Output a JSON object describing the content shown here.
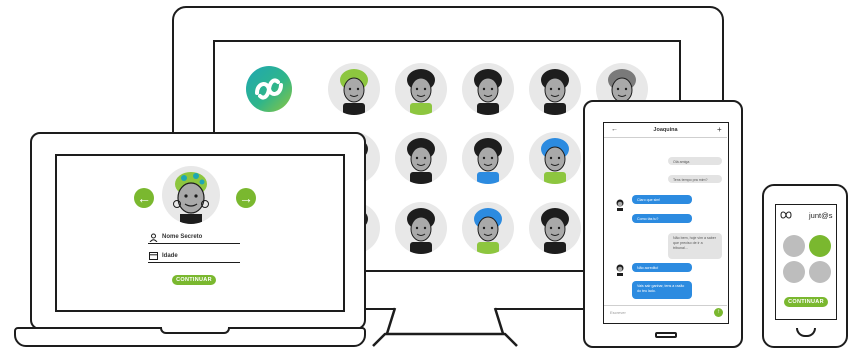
{
  "monitor": {
    "avatars": [
      "avatar-1",
      "avatar-2",
      "avatar-3",
      "avatar-4",
      "avatar-5",
      "avatar-6",
      "avatar-7",
      "avatar-8",
      "avatar-9",
      "avatar-10",
      "avatar-11",
      "avatar-12",
      "avatar-13",
      "avatar-14",
      "avatar-15"
    ]
  },
  "laptop": {
    "name_label": "Nome Secreto",
    "age_label": "Idade",
    "continue_label": "CONTINUAR",
    "prev_glyph": "←",
    "next_glyph": "→"
  },
  "tablet": {
    "title": "Joaquina",
    "back_glyph": "←",
    "add_glyph": "+",
    "messages": [
      {
        "side": "right",
        "text": "Olá amiga"
      },
      {
        "side": "right",
        "text": "Tens tempo pra mim?"
      },
      {
        "side": "left",
        "text": "Claro que sim!"
      },
      {
        "side": "left",
        "text": "Como tás tu?"
      },
      {
        "side": "right",
        "text": "Não bem, hoje vim a saber que preciso de ir a tribunal..."
      },
      {
        "side": "left",
        "text": "Não acredito!"
      },
      {
        "side": "left",
        "text": "Vais sair ganhar, tens a razão do teu lado."
      }
    ],
    "input_placeholder": "Escrever",
    "send_glyph": "↑"
  },
  "phone": {
    "brand": "junt@s",
    "continue_label": "CONTINUAR"
  },
  "colors": {
    "accent_green": "#7ab82f",
    "chat_blue": "#2c8be0",
    "outline": "#1d1d1d"
  }
}
